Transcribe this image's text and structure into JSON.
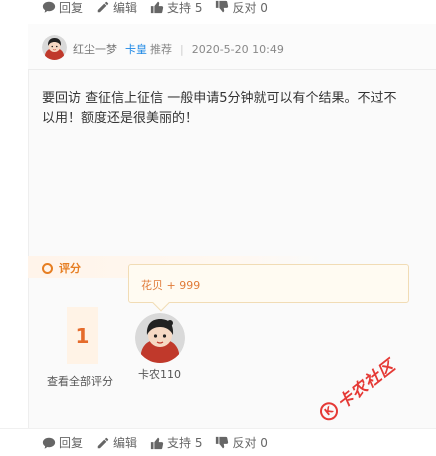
{
  "top_actions": {
    "reply": "回复",
    "edit": "编辑",
    "support": "支持 5",
    "oppose": "反对 0"
  },
  "post": {
    "author": "红尘一梦",
    "badge": "卡皇",
    "recommend": "推荐",
    "separator": "|",
    "time": "2020-5-20 10:49",
    "line1": "要回访 查征信上征信  一般申请5分钟就可以有个结果。不过不",
    "line2": "以用！额度还是很美丽的！"
  },
  "rating": {
    "label": "评分",
    "tooltip": "花贝 + 999",
    "score": "1",
    "view_all": "查看全部评分",
    "rater": "卡农110"
  },
  "bottom_actions": {
    "reply": "回复",
    "edit": "编辑",
    "support": "支持 5",
    "oppose": "反对 0"
  },
  "watermark": {
    "text": "卡农社区",
    "logo_letter": "K"
  },
  "colors": {
    "accent": "#e67e22",
    "badge_blue": "#1e88e5",
    "watermark_red": "#e53935"
  }
}
